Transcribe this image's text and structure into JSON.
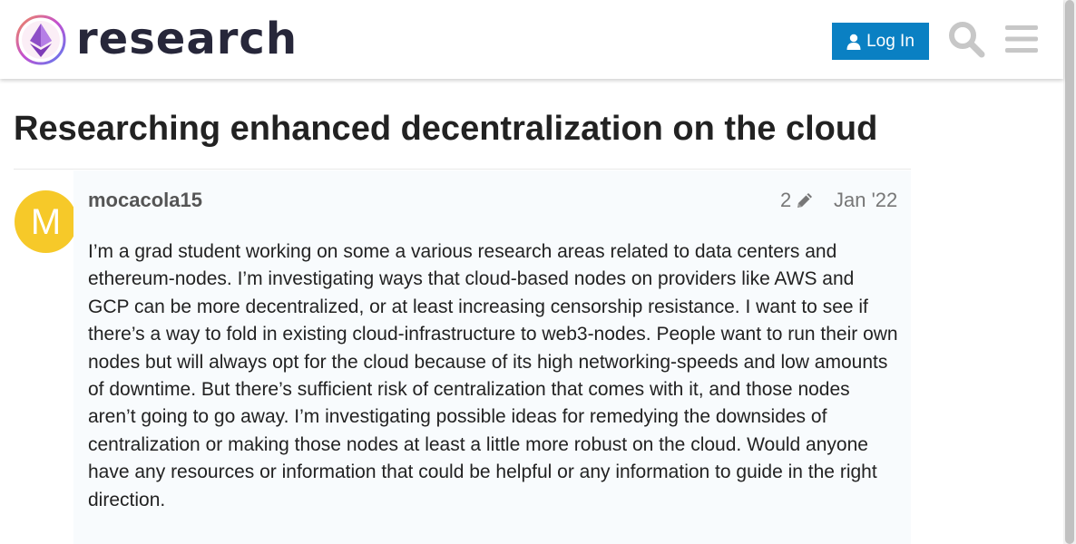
{
  "header": {
    "site_name": "research",
    "login_label": "Log In",
    "icons": {
      "logo": "ethereum-logo-icon",
      "user": "user-icon",
      "search": "search-icon",
      "menu": "hamburger-menu-icon"
    }
  },
  "topic": {
    "title": "Researching enhanced decentralization on the cloud"
  },
  "post": {
    "avatar_letter": "M",
    "avatar_color": "#f6c929",
    "username": "mocacola15",
    "edit_count": "2",
    "date": "Jan '22",
    "body": "I’m a grad student working on some a various research areas related to data centers and ethereum-nodes. I’m investigating ways that cloud-based nodes on providers like AWS and GCP can be more decentralized, or at least increasing censorship resistance. I want to see if there’s a way to fold in existing cloud-infrastructure to web3-nodes. People want to run their own nodes but will always opt for the cloud because of its high networking-speeds and low amounts of downtime. But there’s sufficient risk of centralization that comes with it, and those nodes aren’t going to go away. I’m investigating possible ideas for remedying the downsides of centralization or making those nodes at least a little more robust on the cloud. Would anyone have any resources or information that could be helpful or any information to guide in the right direction."
  },
  "colors": {
    "accent": "#0a80c3",
    "post_background": "#f8fbfd",
    "meta_text": "#777777"
  }
}
